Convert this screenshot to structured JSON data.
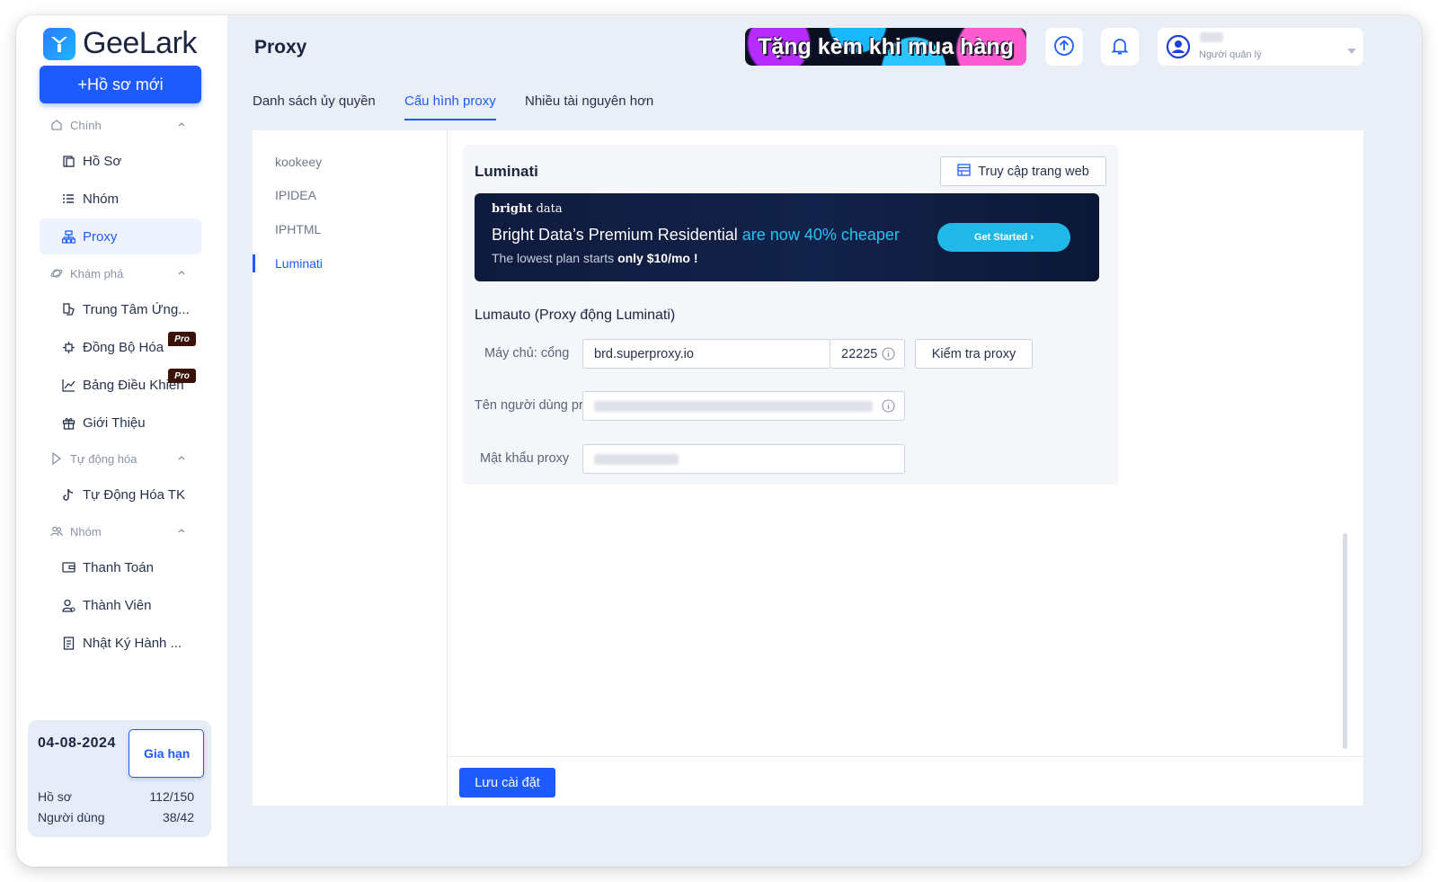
{
  "app": {
    "name": "GeeLark"
  },
  "sidebar": {
    "new_profile_label": "+Hồ sơ mới",
    "sections": {
      "main": "Chính",
      "explore": "Khám phá",
      "automation": "Tự động hóa",
      "group": "Nhóm"
    },
    "items": {
      "profiles": "Hồ Sơ",
      "groups": "Nhóm",
      "proxy": "Proxy",
      "app_center": "Trung Tâm Ứng...",
      "sync": "Đồng Bộ Hóa",
      "dashboard": "Bảng Điều Khiển",
      "referral": "Giới Thiệu",
      "tk_automation": "Tự Động Hóa TK",
      "billing": "Thanh Toán",
      "members": "Thành Viên",
      "activity_log": "Nhật Ký Hành ..."
    },
    "pro_badge": "Pro",
    "expiry": {
      "date": "04-08-2024",
      "renew_label": "Gia hạn",
      "profiles_label": "Hồ sơ",
      "profiles_value": "112/150",
      "users_label": "Người dùng",
      "users_value": "38/42"
    }
  },
  "header": {
    "page_title": "Proxy",
    "promo_text": "Tặng kèm khi mua hàng",
    "user_role": "Người quản lý"
  },
  "tabs": {
    "authorization_list": "Danh sách ủy quyền",
    "proxy_config": "Cấu hình proxy",
    "more_resources": "Nhiều tài nguyên hơn"
  },
  "providers": [
    "kookeey",
    "IPIDEA",
    "IPHTML",
    "Luminati"
  ],
  "config": {
    "provider_title": "Luminati",
    "visit_website_label": "Truy cập trang web",
    "ad": {
      "brand_bold": "bright",
      "brand_light": " data",
      "headline_main": "Bright Data’s Premium Residential ",
      "headline_highlight": "are now 40% cheaper",
      "sub_main": "The lowest plan starts ",
      "sub_bold": "only $10/mo !",
      "cta_label": "Get Started  ›"
    },
    "section_title": "Lumauto (Proxy động Luminati)",
    "host_label": "Máy chủ: cổng",
    "host_value": "brd.superproxy.io",
    "port_value": "22225",
    "check_proxy_label": "Kiểm tra proxy",
    "username_label": "Tên người dùng pr",
    "password_label": "Mật khẩu proxy",
    "save_label": "Lưu cài đặt"
  },
  "colors": {
    "accent": "#1e5bff",
    "sidebar_bg": "#ffffff",
    "app_bg": "#e9eef7",
    "ad_highlight": "#24c3f2"
  }
}
